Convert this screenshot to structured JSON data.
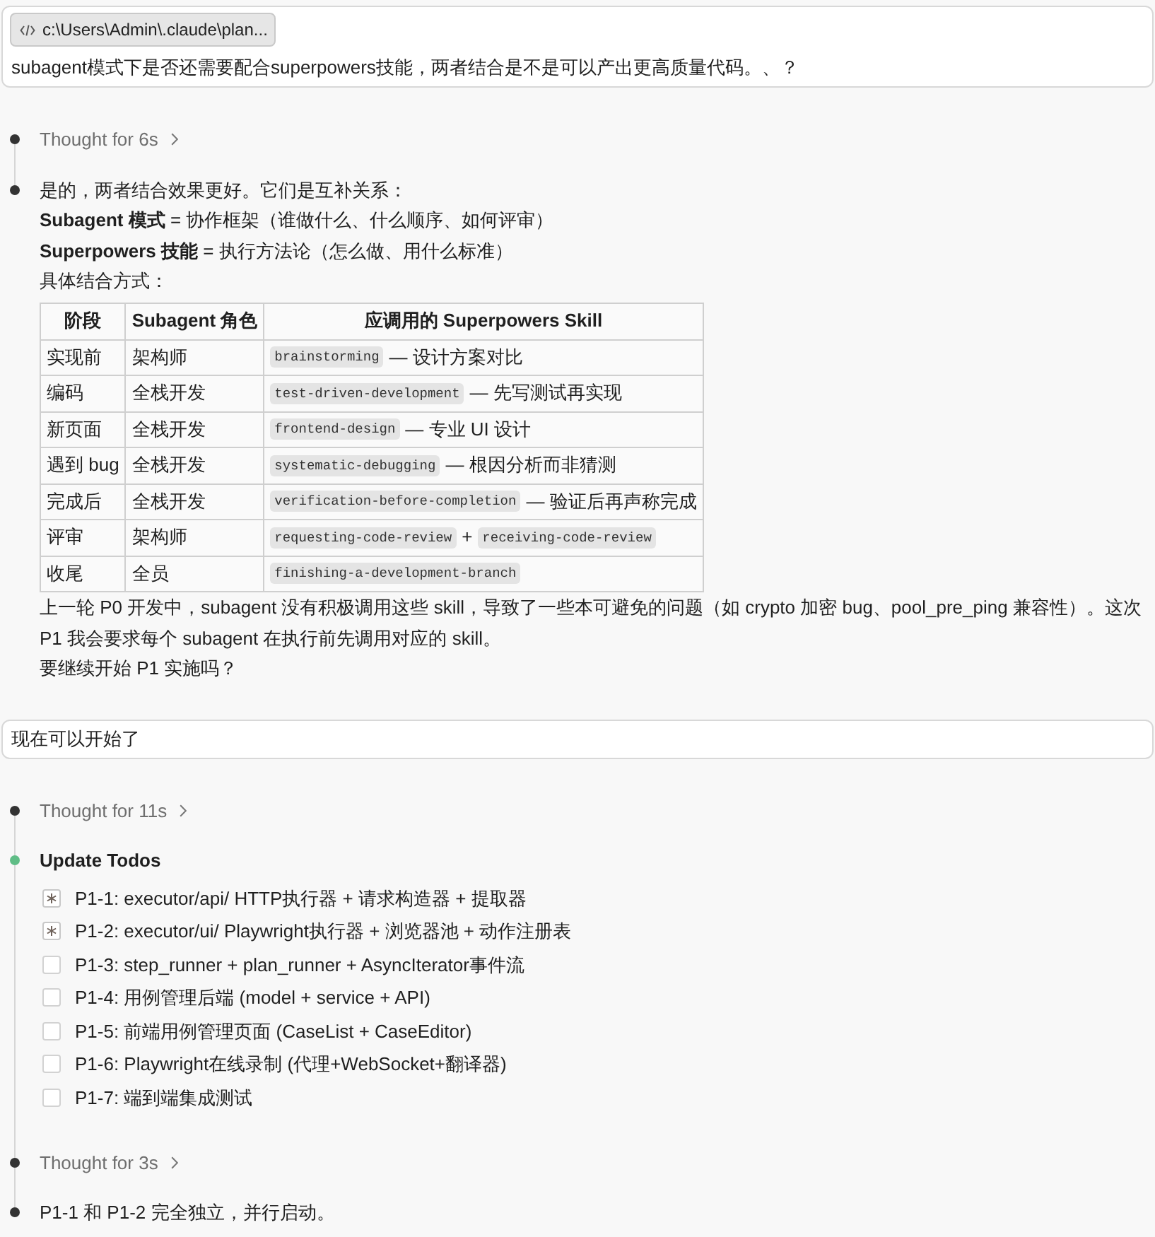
{
  "conversation": [
    {
      "kind": "user",
      "attachment": {
        "label": "c:\\Users\\Admin\\.claude\\plan..."
      },
      "text": "subagent模式下是否还需要配合superpowers技能，两者结合是不是可以产出更高质量代码。、？"
    },
    {
      "kind": "assistant",
      "steps": [
        {
          "kind": "thought",
          "label": "Thought for 6s"
        },
        {
          "kind": "answer",
          "blocks": [
            {
              "kind": "paragraph",
              "text": "是的，两者结合效果更好。它们是互补关系："
            },
            {
              "kind": "paragraph",
              "text": "**Subagent 模式** = 协作框架（谁做什么、什么顺序、如何评审）"
            },
            {
              "kind": "paragraph",
              "text": "**Superpowers 技能** = 执行方法论（怎么做、用什么标准）"
            },
            {
              "kind": "paragraph",
              "text": "具体结合方式："
            },
            {
              "kind": "table",
              "columns": [
                "阶段",
                "Subagent 角色",
                "应调用的 Superpowers Skill"
              ],
              "rows": [
                {
                  "stage": "实现前",
                  "role": "架构师",
                  "skill": [
                    {
                      "kind": "code",
                      "text": "brainstorming"
                    },
                    {
                      "kind": "text",
                      "text": "— 设计方案对比"
                    }
                  ]
                },
                {
                  "stage": "编码",
                  "role": "全栈开发",
                  "skill": [
                    {
                      "kind": "code",
                      "text": "test-driven-development"
                    },
                    {
                      "kind": "text",
                      "text": "— 先写测试再实现"
                    }
                  ]
                },
                {
                  "stage": "新页面",
                  "role": "全栈开发",
                  "skill": [
                    {
                      "kind": "code",
                      "text": "frontend-design"
                    },
                    {
                      "kind": "text",
                      "text": "— 专业 UI 设计"
                    }
                  ]
                },
                {
                  "stage": "遇到 bug",
                  "role": "全栈开发",
                  "skill": [
                    {
                      "kind": "code",
                      "text": "systematic-debugging"
                    },
                    {
                      "kind": "text",
                      "text": "— 根因分析而非猜测"
                    }
                  ]
                },
                {
                  "stage": "完成后",
                  "role": "全栈开发",
                  "skill": [
                    {
                      "kind": "code",
                      "text": "verification-before-completion"
                    },
                    {
                      "kind": "text",
                      "text": "— 验证后再声称完成"
                    }
                  ]
                },
                {
                  "stage": "评审",
                  "role": "架构师",
                  "skill": [
                    {
                      "kind": "code",
                      "text": "requesting-code-review"
                    },
                    {
                      "kind": "text",
                      "text": "+"
                    },
                    {
                      "kind": "code",
                      "text": "receiving-code-review"
                    }
                  ]
                },
                {
                  "stage": "收尾",
                  "role": "全员",
                  "skill": [
                    {
                      "kind": "code",
                      "text": "finishing-a-development-branch"
                    }
                  ]
                }
              ]
            },
            {
              "kind": "paragraph",
              "text": "上一轮 P0 开发中，subagent 没有积极调用这些 skill，导致了一些本可避免的问题（如 crypto 加密 bug、pool_pre_ping 兼容性）。这次 P1 我会要求每个 subagent 在执行前先调用对应的 skill。"
            },
            {
              "kind": "paragraph",
              "text": "要继续开始 P1 实施吗？"
            }
          ]
        }
      ]
    },
    {
      "kind": "user",
      "text": "现在可以开始了"
    },
    {
      "kind": "assistant",
      "steps": [
        {
          "kind": "thought",
          "label": "Thought for 11s"
        },
        {
          "kind": "todos",
          "title": "Update Todos",
          "items": [
            {
              "label": "P1-1: executor/api/ HTTP执行器 + 请求构造器 + 提取器",
              "in_progress": true
            },
            {
              "label": "P1-2: executor/ui/ Playwright执行器 + 浏览器池 + 动作注册表",
              "in_progress": true
            },
            {
              "label": "P1-3: step_runner + plan_runner + AsyncIterator事件流",
              "in_progress": false
            },
            {
              "label": "P1-4: 用例管理后端 (model + service + API)",
              "in_progress": false
            },
            {
              "label": "P1-5: 前端用例管理页面 (CaseList + CaseEditor)",
              "in_progress": false
            },
            {
              "label": "P1-6: Playwright在线录制 (代理+WebSocket+翻译器)",
              "in_progress": false
            },
            {
              "label": "P1-7: 端到端集成测试",
              "in_progress": false
            }
          ]
        },
        {
          "kind": "thought",
          "label": "Thought for 3s"
        },
        {
          "kind": "answer",
          "blocks": [
            {
              "kind": "paragraph",
              "text": "P1-1 和 P1-2 完全独立，并行启动。"
            }
          ]
        }
      ]
    }
  ]
}
